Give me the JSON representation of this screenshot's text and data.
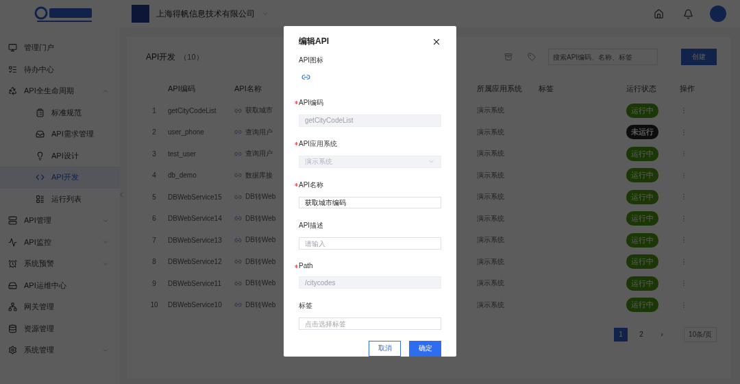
{
  "header": {
    "company": "上海得帆信息技术有限公司"
  },
  "sidebar": {
    "items": [
      {
        "label": "管理门户",
        "selected": false
      },
      {
        "label": "待办中心",
        "selected": false
      },
      {
        "label": "API全生命周期",
        "selected": false,
        "expanded": true,
        "children": [
          {
            "label": "标准规范",
            "selected": false
          },
          {
            "label": "API需求管理",
            "selected": false
          },
          {
            "label": "API设计",
            "selected": false
          },
          {
            "label": "API开发",
            "selected": true
          },
          {
            "label": "运行列表",
            "selected": false
          }
        ]
      },
      {
        "label": "API管理",
        "selected": false,
        "expanded": false
      },
      {
        "label": "API监控",
        "selected": false,
        "expanded": false
      },
      {
        "label": "系统预警",
        "selected": false,
        "expanded": false
      },
      {
        "label": "API运维中心",
        "selected": false
      },
      {
        "label": "网关管理",
        "selected": false
      },
      {
        "label": "资源管理",
        "selected": false
      },
      {
        "label": "系统管理",
        "selected": false,
        "expanded": false
      }
    ]
  },
  "page": {
    "title": "API开发",
    "count": "（10）",
    "search": {
      "placeholder": "搜索API编码、名称、标签"
    },
    "create_button": "创建"
  },
  "table": {
    "columns": [
      "API编码",
      "API名称",
      "所属应用系统",
      "标签",
      "运行状态",
      "操作"
    ],
    "rows": [
      {
        "no": "1",
        "code": "getCityCodeList",
        "name": "获取城市",
        "system": "演示系统",
        "status": {
          "label": "运行中",
          "kind": "running"
        }
      },
      {
        "no": "2",
        "code": "user_phone",
        "name": "查询用户",
        "system": "演示系统",
        "status": {
          "label": "未运行",
          "kind": "stopped"
        }
      },
      {
        "no": "3",
        "code": "test_user",
        "name": "查询用户",
        "system": "演示系统",
        "status": {
          "label": "运行中",
          "kind": "running"
        }
      },
      {
        "no": "4",
        "code": "db_demo",
        "name": "数据库接",
        "system": "演示系统",
        "status": {
          "label": "运行中",
          "kind": "running"
        }
      },
      {
        "no": "5",
        "code": "DBWebService15",
        "name": "DB转Web",
        "system": "演示系统",
        "status": {
          "label": "运行中",
          "kind": "running"
        }
      },
      {
        "no": "6",
        "code": "DBWebService14",
        "name": "DB转Web",
        "system": "演示系统",
        "status": {
          "label": "运行中",
          "kind": "running"
        }
      },
      {
        "no": "7",
        "code": "DBWebService13",
        "name": "DB转Web",
        "system": "演示系统",
        "status": {
          "label": "运行中",
          "kind": "running"
        }
      },
      {
        "no": "8",
        "code": "DBWebService12",
        "name": "DB转Web",
        "system": "演示系统",
        "status": {
          "label": "运行中",
          "kind": "running"
        }
      },
      {
        "no": "9",
        "code": "DBWebService11",
        "name": "DB转Web",
        "system": "演示系统",
        "status": {
          "label": "运行中",
          "kind": "running"
        }
      },
      {
        "no": "10",
        "code": "DBWebService10",
        "name": "DB转Web",
        "system": "演示系统",
        "status": {
          "label": "运行中",
          "kind": "running"
        }
      }
    ]
  },
  "pagination": {
    "pages": [
      {
        "label": "1",
        "selected": true
      },
      {
        "label": "2",
        "selected": false
      }
    ],
    "next": "›",
    "page_size": "10条/页"
  },
  "dialog": {
    "title": "编辑API",
    "fields": [
      {
        "kind": "icon",
        "label": "API图标",
        "required": false
      },
      {
        "kind": "input",
        "label": "API编码",
        "required": true,
        "disabled": true,
        "value": "getCityCodeList"
      },
      {
        "kind": "select",
        "label": "API应用系统",
        "required": true,
        "disabled": true,
        "value": "演示系统"
      },
      {
        "kind": "input",
        "label": "API名称",
        "required": true,
        "disabled": false,
        "value": "获取城市编码"
      },
      {
        "kind": "input",
        "label": "API描述",
        "required": false,
        "disabled": false,
        "placeholder": "请输入"
      },
      {
        "kind": "input",
        "label": "Path",
        "required": true,
        "disabled": true,
        "value": "/citycodes"
      },
      {
        "kind": "input",
        "label": "标签",
        "required": false,
        "disabled": false,
        "placeholder": "点击选择标签"
      }
    ],
    "buttons": [
      {
        "label": "取消",
        "kind": "secondary"
      },
      {
        "label": "确定",
        "kind": "primary"
      }
    ]
  }
}
